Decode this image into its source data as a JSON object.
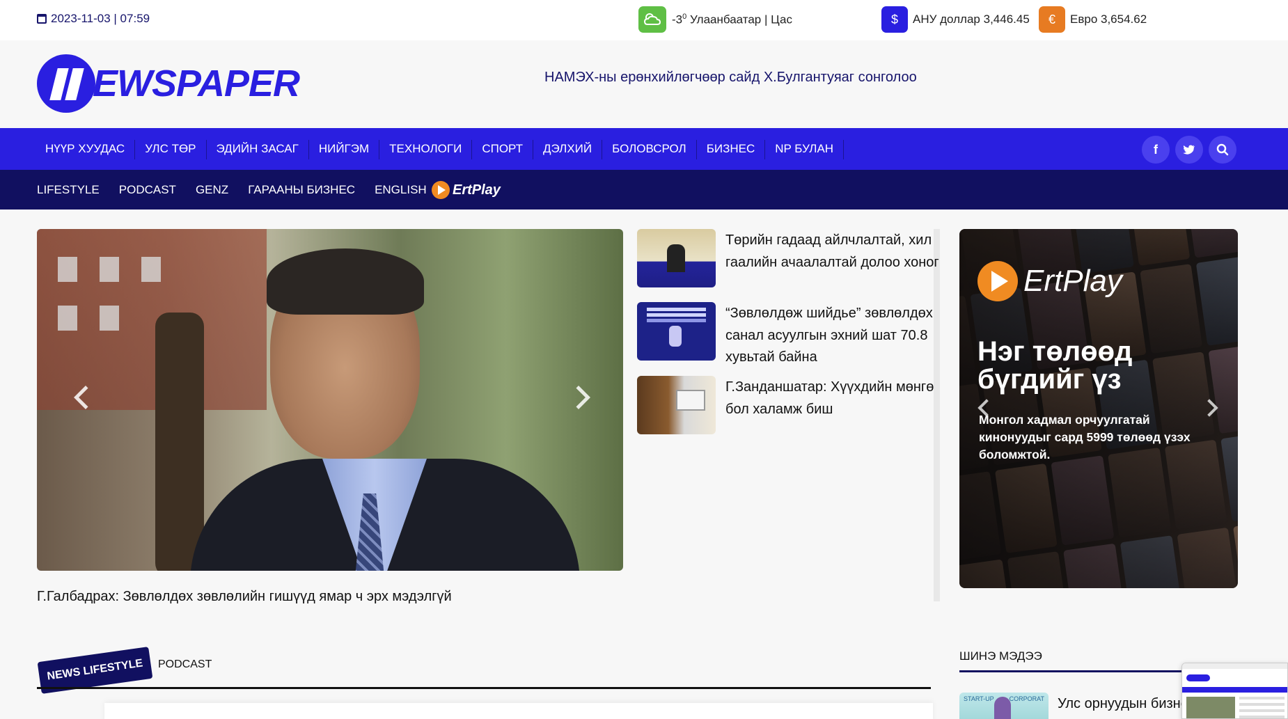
{
  "topbar": {
    "datetime": "2023-11-03 | 07:59",
    "weather_temp": "-3",
    "weather_degree": "0",
    "weather_place": "Улаанбаатар | Цас",
    "usd_symbol": "$",
    "usd_rate": "АНУ доллар 3,446.45",
    "eur_symbol": "€",
    "eur_rate": "Евро 3,654.62"
  },
  "header": {
    "logo_text": "EWSPAPER",
    "headline": "НАМЭХ-ны ерөнхийлөгчөөр сайд Х.Булгантуяаг сонголоо"
  },
  "main_nav": [
    "НҮҮР ХУУДАС",
    "УЛС ТӨР",
    "ЭДИЙН ЗАСАГ",
    "НИЙГЭМ",
    "ТЕХНОЛОГИ",
    "СПОРТ",
    "ДЭЛХИЙ",
    "БОЛОВСРОЛ",
    "БИЗНЕС",
    "NP БУЛАН"
  ],
  "social": {
    "facebook": "f",
    "twitter": "t"
  },
  "sub_nav": [
    "LIFESTYLE",
    "PODCAST",
    "GENZ",
    "ГАРААНЫ БИЗНЕС",
    "ENGLISH"
  ],
  "ertplay_label": "ErtPlay",
  "hero": {
    "caption": "Г.Галбадрах: Зөвлөлдөх зөвлөлийн гишүүд ямар ч эрх мэдэлгүй"
  },
  "side_news": [
    {
      "title": "Төрийн гадаад айлчлалтай, хил гаалийн ачаалалтай долоо хоног"
    },
    {
      "title": "“Зөвлөлдөж шийдье” зөвлөлдөх санал асуулгын эхний шат 70.8 хувьтай байна"
    },
    {
      "title": "Г.Занданшатар: Хүүхдийн мөнгө бол халамж биш"
    }
  ],
  "ad": {
    "brand": "ErtPlay",
    "headline": "Нэг төлөөд бүгдийг үз",
    "body": "Монгол хадмал орчуулгатай кинонуудыг сард 5999 төлөөд үзэх боломжтой."
  },
  "section": {
    "tag": "NEWS LIFESTYLE",
    "tab": "PODCAST"
  },
  "latest": {
    "heading": "ШИНЭ МЭДЭЭ",
    "thumb_left": "START-UP",
    "thumb_right": "CORPORAT",
    "first_title": "Улс орнуудын бизнес"
  },
  "colors": {
    "primary": "#2a1fe0",
    "navy": "#111060",
    "orange": "#e77b22",
    "weather_green": "#5fbf45"
  }
}
